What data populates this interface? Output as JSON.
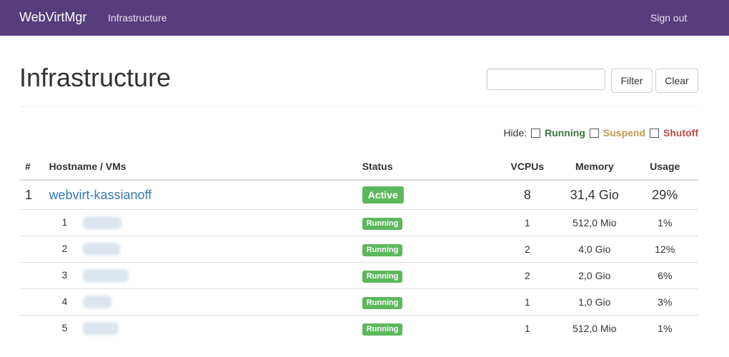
{
  "navbar": {
    "brand": "WebVirtMgr",
    "infrastructure_link": "Infrastructure",
    "signout_link": "Sign out"
  },
  "page": {
    "title": "Infrastructure"
  },
  "search": {
    "placeholder": "",
    "value": "",
    "filter_label": "Filter",
    "clear_label": "Clear"
  },
  "hide_filter": {
    "label": "Hide:",
    "options": [
      {
        "label": "Running",
        "color": "#3c763d",
        "checked": false
      },
      {
        "label": "Suspend",
        "color": "#c09853",
        "checked": false
      },
      {
        "label": "Shutoff",
        "color": "#b94a48",
        "checked": false
      }
    ]
  },
  "table": {
    "headers": {
      "num": "#",
      "hostname": "Hostname / VMs",
      "status": "Status",
      "vcpus": "VCPUs",
      "memory": "Memory",
      "usage": "Usage"
    },
    "host": {
      "num": "1",
      "name": "webvirt-kassianoff",
      "status": "Active",
      "vcpus": "8",
      "memory": "31,4 Gio",
      "usage": "29%"
    },
    "vms": [
      {
        "num": "1",
        "status": "Running",
        "vcpus": "1",
        "memory": "512,0 Mio",
        "usage": "1%"
      },
      {
        "num": "2",
        "status": "Running",
        "vcpus": "2",
        "memory": "4,0 Gio",
        "usage": "12%"
      },
      {
        "num": "3",
        "status": "Running",
        "vcpus": "2",
        "memory": "2,0 Gio",
        "usage": "6%"
      },
      {
        "num": "4",
        "status": "Running",
        "vcpus": "1",
        "memory": "1,0 Gio",
        "usage": "3%"
      },
      {
        "num": "5",
        "status": "Running",
        "vcpus": "1",
        "memory": "512,0 Mio",
        "usage": "1%"
      }
    ]
  },
  "colors": {
    "navbar": "#563d7c",
    "link": "#337ab7",
    "status_green": "#5cb85c"
  }
}
